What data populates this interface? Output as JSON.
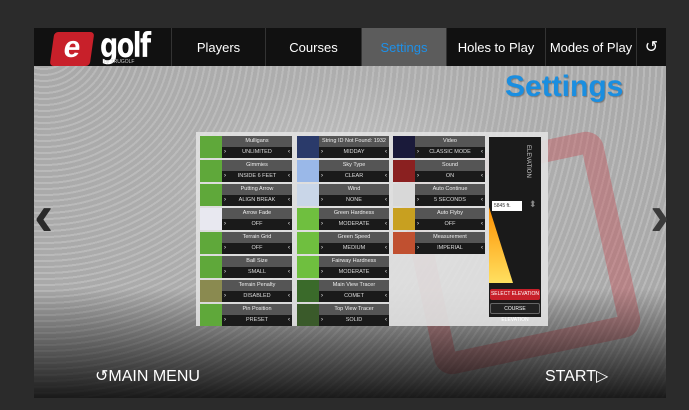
{
  "nav": {
    "logo_letter": "e",
    "logo_word": "golf",
    "logo_byline": "by TRUGOLF",
    "tabs": [
      "Players",
      "Courses",
      "Settings",
      "Holes to Play",
      "Modes of Play"
    ],
    "back_icon_glyph": "↺"
  },
  "page": {
    "title": "Settings"
  },
  "settings": [
    {
      "name": "Mulligans",
      "value": "UNLIMITED"
    },
    {
      "name": "String ID Not Found: 1932",
      "value": "MIDDAY"
    },
    {
      "name": "Video",
      "value": "CLASSIC MODE"
    },
    {
      "name": "Gimmies",
      "value": "INSIDE 6 FEET"
    },
    {
      "name": "Sky Type",
      "value": "CLEAR"
    },
    {
      "name": "Sound",
      "value": "ON"
    },
    {
      "name": "Putting Arrow",
      "value": "ALIGN BREAK"
    },
    {
      "name": "Wind",
      "value": "NONE"
    },
    {
      "name": "Auto Continue",
      "value": "5 SECONDS"
    },
    {
      "name": "Arrow Fade",
      "value": "OFF"
    },
    {
      "name": "Green Hardness",
      "value": "MODERATE"
    },
    {
      "name": "Auto Flyby",
      "value": "OFF"
    },
    {
      "name": "Terrain Grid",
      "value": "OFF"
    },
    {
      "name": "Green Speed",
      "value": "MEDIUM"
    },
    {
      "name": "Measurement",
      "value": "IMPERIAL"
    },
    {
      "name": "Ball Size",
      "value": "SMALL"
    },
    {
      "name": "Fairway Hardness",
      "value": "MODERATE"
    },
    {
      "name": "Terrain Penalty",
      "value": "DISABLED"
    },
    {
      "name": "Main View Tracer",
      "value": "COMET"
    },
    {
      "name": "Pin Position",
      "value": "PRESET"
    },
    {
      "name": "Top View Tracer",
      "value": "SOLID"
    }
  ],
  "elevation": {
    "label": "ELEVATION",
    "value": "5845",
    "unit": "ft.",
    "select_button": "SELECT ELEVATION",
    "course_button": "COURSE ELEVATION"
  },
  "footer": {
    "main_menu": "MAIN MENU",
    "main_menu_icon": "↺",
    "start": "START",
    "start_icon": "▷"
  },
  "colors": {
    "accent": "#1a8ee0",
    "brand_red": "#c8202a"
  }
}
